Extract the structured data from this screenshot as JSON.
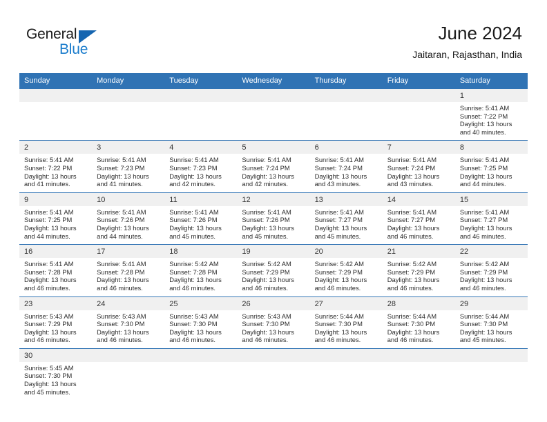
{
  "brand": {
    "word_one": "General",
    "word_two": "Blue",
    "accent_color": "#1a7ccc",
    "triangle_color": "#1565b0"
  },
  "header": {
    "title": "June 2024",
    "subtitle": "Jaitaran, Rajasthan, India"
  },
  "theme": {
    "header_blue": "#3073b4",
    "daynum_band": "#f0f0f0",
    "text": "#222222"
  },
  "weekday_headers": [
    "Sunday",
    "Monday",
    "Tuesday",
    "Wednesday",
    "Thursday",
    "Friday",
    "Saturday"
  ],
  "weeks": [
    {
      "days": [
        {
          "num": "",
          "empty": true,
          "lines": []
        },
        {
          "num": "",
          "empty": true,
          "lines": []
        },
        {
          "num": "",
          "empty": true,
          "lines": []
        },
        {
          "num": "",
          "empty": true,
          "lines": []
        },
        {
          "num": "",
          "empty": true,
          "lines": []
        },
        {
          "num": "",
          "empty": true,
          "lines": []
        },
        {
          "num": "1",
          "empty": false,
          "lines": [
            "Sunrise: 5:41 AM",
            "Sunset: 7:22 PM",
            "Daylight: 13 hours",
            "and 40 minutes."
          ]
        }
      ]
    },
    {
      "days": [
        {
          "num": "2",
          "empty": false,
          "lines": [
            "Sunrise: 5:41 AM",
            "Sunset: 7:22 PM",
            "Daylight: 13 hours",
            "and 41 minutes."
          ]
        },
        {
          "num": "3",
          "empty": false,
          "lines": [
            "Sunrise: 5:41 AM",
            "Sunset: 7:23 PM",
            "Daylight: 13 hours",
            "and 41 minutes."
          ]
        },
        {
          "num": "4",
          "empty": false,
          "lines": [
            "Sunrise: 5:41 AM",
            "Sunset: 7:23 PM",
            "Daylight: 13 hours",
            "and 42 minutes."
          ]
        },
        {
          "num": "5",
          "empty": false,
          "lines": [
            "Sunrise: 5:41 AM",
            "Sunset: 7:24 PM",
            "Daylight: 13 hours",
            "and 42 minutes."
          ]
        },
        {
          "num": "6",
          "empty": false,
          "lines": [
            "Sunrise: 5:41 AM",
            "Sunset: 7:24 PM",
            "Daylight: 13 hours",
            "and 43 minutes."
          ]
        },
        {
          "num": "7",
          "empty": false,
          "lines": [
            "Sunrise: 5:41 AM",
            "Sunset: 7:24 PM",
            "Daylight: 13 hours",
            "and 43 minutes."
          ]
        },
        {
          "num": "8",
          "empty": false,
          "lines": [
            "Sunrise: 5:41 AM",
            "Sunset: 7:25 PM",
            "Daylight: 13 hours",
            "and 44 minutes."
          ]
        }
      ]
    },
    {
      "days": [
        {
          "num": "9",
          "empty": false,
          "lines": [
            "Sunrise: 5:41 AM",
            "Sunset: 7:25 PM",
            "Daylight: 13 hours",
            "and 44 minutes."
          ]
        },
        {
          "num": "10",
          "empty": false,
          "lines": [
            "Sunrise: 5:41 AM",
            "Sunset: 7:26 PM",
            "Daylight: 13 hours",
            "and 44 minutes."
          ]
        },
        {
          "num": "11",
          "empty": false,
          "lines": [
            "Sunrise: 5:41 AM",
            "Sunset: 7:26 PM",
            "Daylight: 13 hours",
            "and 45 minutes."
          ]
        },
        {
          "num": "12",
          "empty": false,
          "lines": [
            "Sunrise: 5:41 AM",
            "Sunset: 7:26 PM",
            "Daylight: 13 hours",
            "and 45 minutes."
          ]
        },
        {
          "num": "13",
          "empty": false,
          "lines": [
            "Sunrise: 5:41 AM",
            "Sunset: 7:27 PM",
            "Daylight: 13 hours",
            "and 45 minutes."
          ]
        },
        {
          "num": "14",
          "empty": false,
          "lines": [
            "Sunrise: 5:41 AM",
            "Sunset: 7:27 PM",
            "Daylight: 13 hours",
            "and 46 minutes."
          ]
        },
        {
          "num": "15",
          "empty": false,
          "lines": [
            "Sunrise: 5:41 AM",
            "Sunset: 7:27 PM",
            "Daylight: 13 hours",
            "and 46 minutes."
          ]
        }
      ]
    },
    {
      "days": [
        {
          "num": "16",
          "empty": false,
          "lines": [
            "Sunrise: 5:41 AM",
            "Sunset: 7:28 PM",
            "Daylight: 13 hours",
            "and 46 minutes."
          ]
        },
        {
          "num": "17",
          "empty": false,
          "lines": [
            "Sunrise: 5:41 AM",
            "Sunset: 7:28 PM",
            "Daylight: 13 hours",
            "and 46 minutes."
          ]
        },
        {
          "num": "18",
          "empty": false,
          "lines": [
            "Sunrise: 5:42 AM",
            "Sunset: 7:28 PM",
            "Daylight: 13 hours",
            "and 46 minutes."
          ]
        },
        {
          "num": "19",
          "empty": false,
          "lines": [
            "Sunrise: 5:42 AM",
            "Sunset: 7:29 PM",
            "Daylight: 13 hours",
            "and 46 minutes."
          ]
        },
        {
          "num": "20",
          "empty": false,
          "lines": [
            "Sunrise: 5:42 AM",
            "Sunset: 7:29 PM",
            "Daylight: 13 hours",
            "and 46 minutes."
          ]
        },
        {
          "num": "21",
          "empty": false,
          "lines": [
            "Sunrise: 5:42 AM",
            "Sunset: 7:29 PM",
            "Daylight: 13 hours",
            "and 46 minutes."
          ]
        },
        {
          "num": "22",
          "empty": false,
          "lines": [
            "Sunrise: 5:42 AM",
            "Sunset: 7:29 PM",
            "Daylight: 13 hours",
            "and 46 minutes."
          ]
        }
      ]
    },
    {
      "days": [
        {
          "num": "23",
          "empty": false,
          "lines": [
            "Sunrise: 5:43 AM",
            "Sunset: 7:29 PM",
            "Daylight: 13 hours",
            "and 46 minutes."
          ]
        },
        {
          "num": "24",
          "empty": false,
          "lines": [
            "Sunrise: 5:43 AM",
            "Sunset: 7:30 PM",
            "Daylight: 13 hours",
            "and 46 minutes."
          ]
        },
        {
          "num": "25",
          "empty": false,
          "lines": [
            "Sunrise: 5:43 AM",
            "Sunset: 7:30 PM",
            "Daylight: 13 hours",
            "and 46 minutes."
          ]
        },
        {
          "num": "26",
          "empty": false,
          "lines": [
            "Sunrise: 5:43 AM",
            "Sunset: 7:30 PM",
            "Daylight: 13 hours",
            "and 46 minutes."
          ]
        },
        {
          "num": "27",
          "empty": false,
          "lines": [
            "Sunrise: 5:44 AM",
            "Sunset: 7:30 PM",
            "Daylight: 13 hours",
            "and 46 minutes."
          ]
        },
        {
          "num": "28",
          "empty": false,
          "lines": [
            "Sunrise: 5:44 AM",
            "Sunset: 7:30 PM",
            "Daylight: 13 hours",
            "and 46 minutes."
          ]
        },
        {
          "num": "29",
          "empty": false,
          "lines": [
            "Sunrise: 5:44 AM",
            "Sunset: 7:30 PM",
            "Daylight: 13 hours",
            "and 45 minutes."
          ]
        }
      ]
    },
    {
      "days": [
        {
          "num": "30",
          "empty": false,
          "lines": [
            "Sunrise: 5:45 AM",
            "Sunset: 7:30 PM",
            "Daylight: 13 hours",
            "and 45 minutes."
          ]
        },
        {
          "num": "",
          "empty": true,
          "lines": []
        },
        {
          "num": "",
          "empty": true,
          "lines": []
        },
        {
          "num": "",
          "empty": true,
          "lines": []
        },
        {
          "num": "",
          "empty": true,
          "lines": []
        },
        {
          "num": "",
          "empty": true,
          "lines": []
        },
        {
          "num": "",
          "empty": true,
          "lines": []
        }
      ]
    }
  ]
}
